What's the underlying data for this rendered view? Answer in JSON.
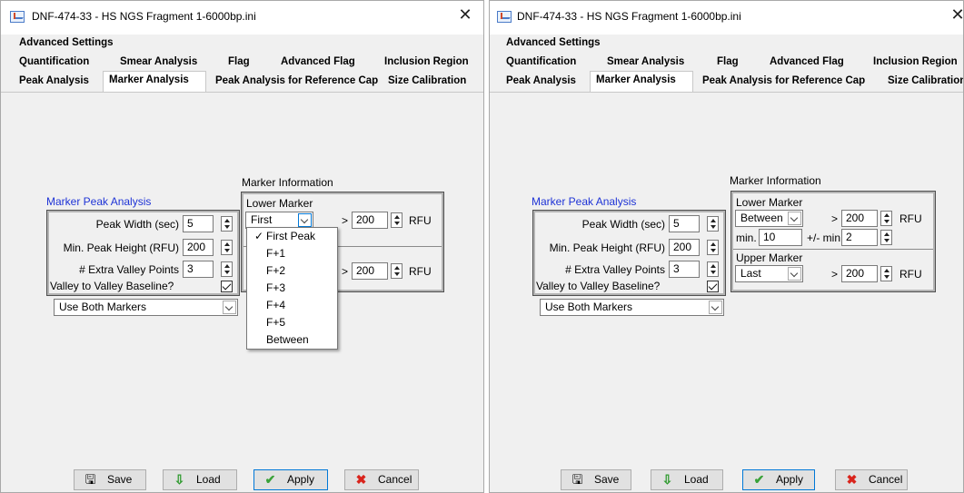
{
  "window_title": "DNF-474-33 - HS NGS Fragment 1-6000bp.ini",
  "close_glyph": "✕",
  "tabs": {
    "row1": [
      "Advanced Settings"
    ],
    "row2": [
      "Quantification",
      "Smear Analysis",
      "Flag",
      "Advanced Flag",
      "Inclusion Region"
    ],
    "row3": [
      "Peak Analysis",
      "Marker Analysis",
      "Peak Analysis for Reference Cap",
      "Size Calibration"
    ],
    "selected": "Marker Analysis"
  },
  "marker_peak": {
    "heading": "Marker Peak Analysis",
    "peak_width_label": "Peak Width (sec)",
    "peak_width_value": "5",
    "min_height_label": "Min. Peak Height (RFU)",
    "min_height_value": "200",
    "extra_valley_label": "# Extra Valley Points",
    "extra_valley_value": "3",
    "valley_baseline_label": "Valley to Valley Baseline?",
    "valley_baseline_checked": true,
    "marker_mode": "Use Both Markers"
  },
  "marker_info": {
    "heading": "Marker Information",
    "lower_label": "Lower Marker",
    "upper_label": "Upper Marker",
    "gt": ">",
    "rfu": "RFU",
    "min_label": "min.",
    "pm_label": "+/- min."
  },
  "window1": {
    "lower_value": "First",
    "lower_rfu": "200",
    "upper_rfu": "200",
    "dropdown_options": [
      "First Peak",
      "F+1",
      "F+2",
      "F+3",
      "F+4",
      "F+5",
      "Between"
    ],
    "dropdown_checked": "First Peak",
    "check_glyph": "✓"
  },
  "window2": {
    "lower_value": "Between",
    "lower_rfu": "200",
    "min_value": "10",
    "pm_value": "2",
    "upper_value": "Last",
    "upper_rfu": "200"
  },
  "buttons": {
    "save": "Save",
    "load": "Load",
    "apply": "Apply",
    "cancel": "Cancel"
  },
  "colors": {
    "heading_blue": "#1e33d6",
    "apply_border": "#0078d7",
    "cancel_icon": "#d9241c",
    "apply_icon": "#3aa23a",
    "load_icon": "#2e9a2e"
  }
}
